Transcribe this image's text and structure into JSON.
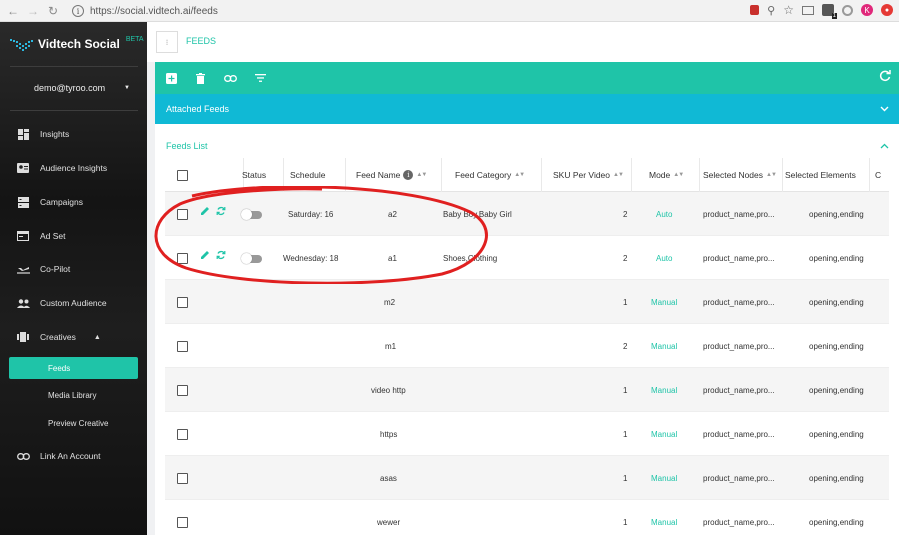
{
  "browser": {
    "url": "https://social.vidtech.ai/feeds",
    "profile_initial": "K",
    "extension_badge": "1"
  },
  "sidebar": {
    "app_name": "Vidtech Social",
    "app_badge": "BETA",
    "user_email": "demo@tyroo.com",
    "items": [
      {
        "label": "Insights",
        "icon": "insights-grid-icon"
      },
      {
        "label": "Audience Insights",
        "icon": "audience-card-icon"
      },
      {
        "label": "Campaigns",
        "icon": "campaigns-icon"
      },
      {
        "label": "Ad Set",
        "icon": "adset-icon"
      },
      {
        "label": "Co-Pilot",
        "icon": "plane-icon"
      },
      {
        "label": "Custom Audience",
        "icon": "people-icon"
      },
      {
        "label": "Creatives",
        "icon": "creatives-icon"
      }
    ],
    "creatives_sub": [
      "Feeds",
      "Media Library",
      "Preview Creative"
    ],
    "active_sub": "Feeds",
    "link_account": "Link An Account"
  },
  "header": {
    "box_glyph": "⁝",
    "title": "FEEDS"
  },
  "sections": {
    "attached": "Attached Feeds",
    "list": "Feeds List"
  },
  "table": {
    "headers": [
      "Status",
      "Schedule",
      "Feed Name",
      "Feed Category",
      "SKU Per Video",
      "Mode",
      "Selected Nodes",
      "Selected Elements",
      "C"
    ],
    "rows": [
      {
        "actions": true,
        "status_toggle": false,
        "schedule": "Saturday: 16",
        "name": "a2",
        "category": "Baby Boy,Baby Girl",
        "sku": "2",
        "mode": "Auto",
        "nodes": "product_name,pro...",
        "elements": "opening,ending"
      },
      {
        "actions": true,
        "status_toggle": false,
        "schedule": "Wednesday: 18",
        "name": "a1",
        "category": "Shoes,Clothing",
        "sku": "2",
        "mode": "Auto",
        "nodes": "product_name,pro...",
        "elements": "opening,ending"
      },
      {
        "actions": false,
        "schedule": "",
        "name": "m2",
        "category": "",
        "sku": "1",
        "mode": "Manual",
        "nodes": "product_name,pro...",
        "elements": "opening,ending"
      },
      {
        "actions": false,
        "schedule": "",
        "name": "m1",
        "category": "",
        "sku": "2",
        "mode": "Manual",
        "nodes": "product_name,pro...",
        "elements": "opening,ending"
      },
      {
        "actions": false,
        "schedule": "",
        "name": "video http",
        "category": "",
        "sku": "1",
        "mode": "Manual",
        "nodes": "product_name,pro...",
        "elements": "opening,ending"
      },
      {
        "actions": false,
        "schedule": "",
        "name": "https",
        "category": "",
        "sku": "1",
        "mode": "Manual",
        "nodes": "product_name,pro...",
        "elements": "opening,ending"
      },
      {
        "actions": false,
        "schedule": "",
        "name": "asas",
        "category": "",
        "sku": "1",
        "mode": "Manual",
        "nodes": "product_name,pro...",
        "elements": "opening,ending"
      },
      {
        "actions": false,
        "schedule": "",
        "name": "wewer",
        "category": "",
        "sku": "1",
        "mode": "Manual",
        "nodes": "product_name,pro...",
        "elements": "opening,ending"
      }
    ]
  },
  "colors": {
    "accent": "#1fc4a8",
    "cyan_bar": "#10b9d5",
    "annotation": "#e02020"
  }
}
